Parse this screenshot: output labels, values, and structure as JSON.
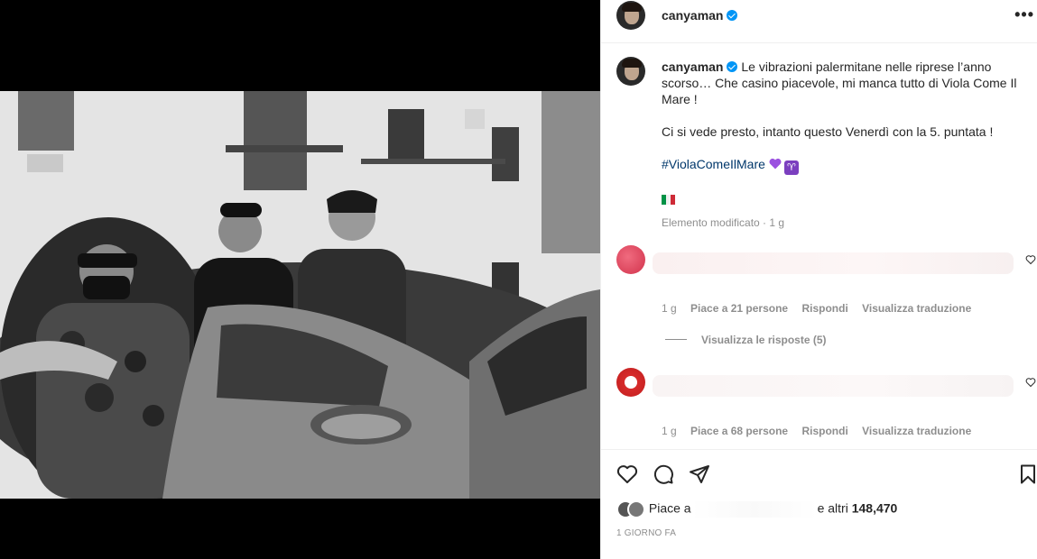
{
  "post": {
    "author": "canyaman",
    "verified": true
  },
  "caption": {
    "author": "canyaman",
    "line1": "Le vibrazioni palermitane nelle riprese l’anno scorso… Che casino piacevole, mi manca tutto di Viola Come Il Mare !",
    "line2": "Ci si vede presto, intanto questo Venerdì con la 5. puntata !",
    "hashtag": "#ViolaComeIlMare",
    "aries_glyph": "♈",
    "meta": "Elemento modificato · 1 g"
  },
  "comments": [
    {
      "age": "1 g",
      "likes": "Piace a 21 persone",
      "reply": "Rispondi",
      "translate": "Visualizza traduzione",
      "view_replies": "Visualizza le risposte (5)"
    },
    {
      "age": "1 g",
      "likes": "Piace a 68 persone",
      "reply": "Rispondi",
      "translate": "Visualizza traduzione"
    }
  ],
  "likes": {
    "prefix": "Piace a",
    "suffix": "e altri",
    "count": "148,470"
  },
  "timestamp": "1 giorno fa",
  "colors": {
    "verified": "#0095f6",
    "hashtag": "#00376b",
    "muted": "#8e8e8e",
    "text": "#262626"
  },
  "icons": [
    "more-icon",
    "heart-icon",
    "comment-icon",
    "share-icon",
    "save-icon",
    "verified-badge-icon"
  ]
}
